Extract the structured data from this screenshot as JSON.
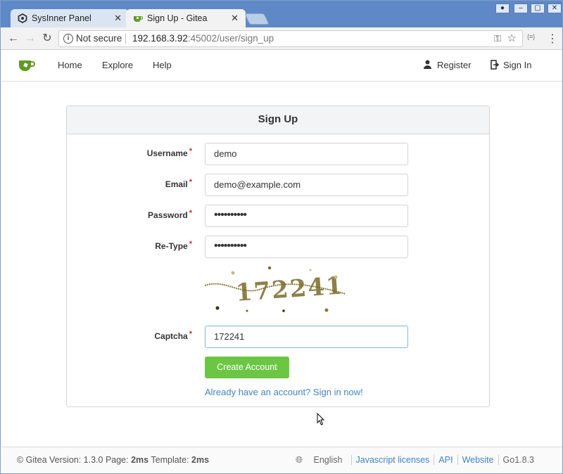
{
  "browser": {
    "tabs": [
      {
        "title": "SysInner Panel",
        "close": "✕"
      },
      {
        "title": "Sign Up - Gitea",
        "close": "✕"
      }
    ],
    "address": {
      "security": "Not secure",
      "host": "192.168.3.92",
      "rest": ":45002/user/sign_up"
    },
    "ext_label": "{≡}"
  },
  "nav": {
    "home": "Home",
    "explore": "Explore",
    "help": "Help",
    "register": "Register",
    "signin": "Sign In"
  },
  "form": {
    "title": "Sign Up",
    "required_mark": "*",
    "fields": {
      "username": {
        "label": "Username",
        "value": "demo"
      },
      "email": {
        "label": "Email",
        "value": "demo@example.com"
      },
      "password": {
        "label": "Password",
        "value": "••••••••••"
      },
      "retype": {
        "label": "Re-Type",
        "value": "••••••••••"
      },
      "captcha": {
        "label": "Captcha",
        "value": "172241"
      }
    },
    "captcha_image_text": "172241",
    "submit": "Create Account",
    "signin_link": "Already have an account? Sign in now!"
  },
  "footer": {
    "prefix": "© Gitea Version: 1.3.0 Page: ",
    "page_time": "2ms",
    "mid": " Template: ",
    "template_time": "2ms",
    "language": "English",
    "links": [
      "Javascript licenses",
      "API",
      "Website"
    ],
    "go_version": "Go1.8.3"
  },
  "colors": {
    "accent": "#6cc644",
    "link": "#4183c4",
    "required": "#db2828"
  }
}
